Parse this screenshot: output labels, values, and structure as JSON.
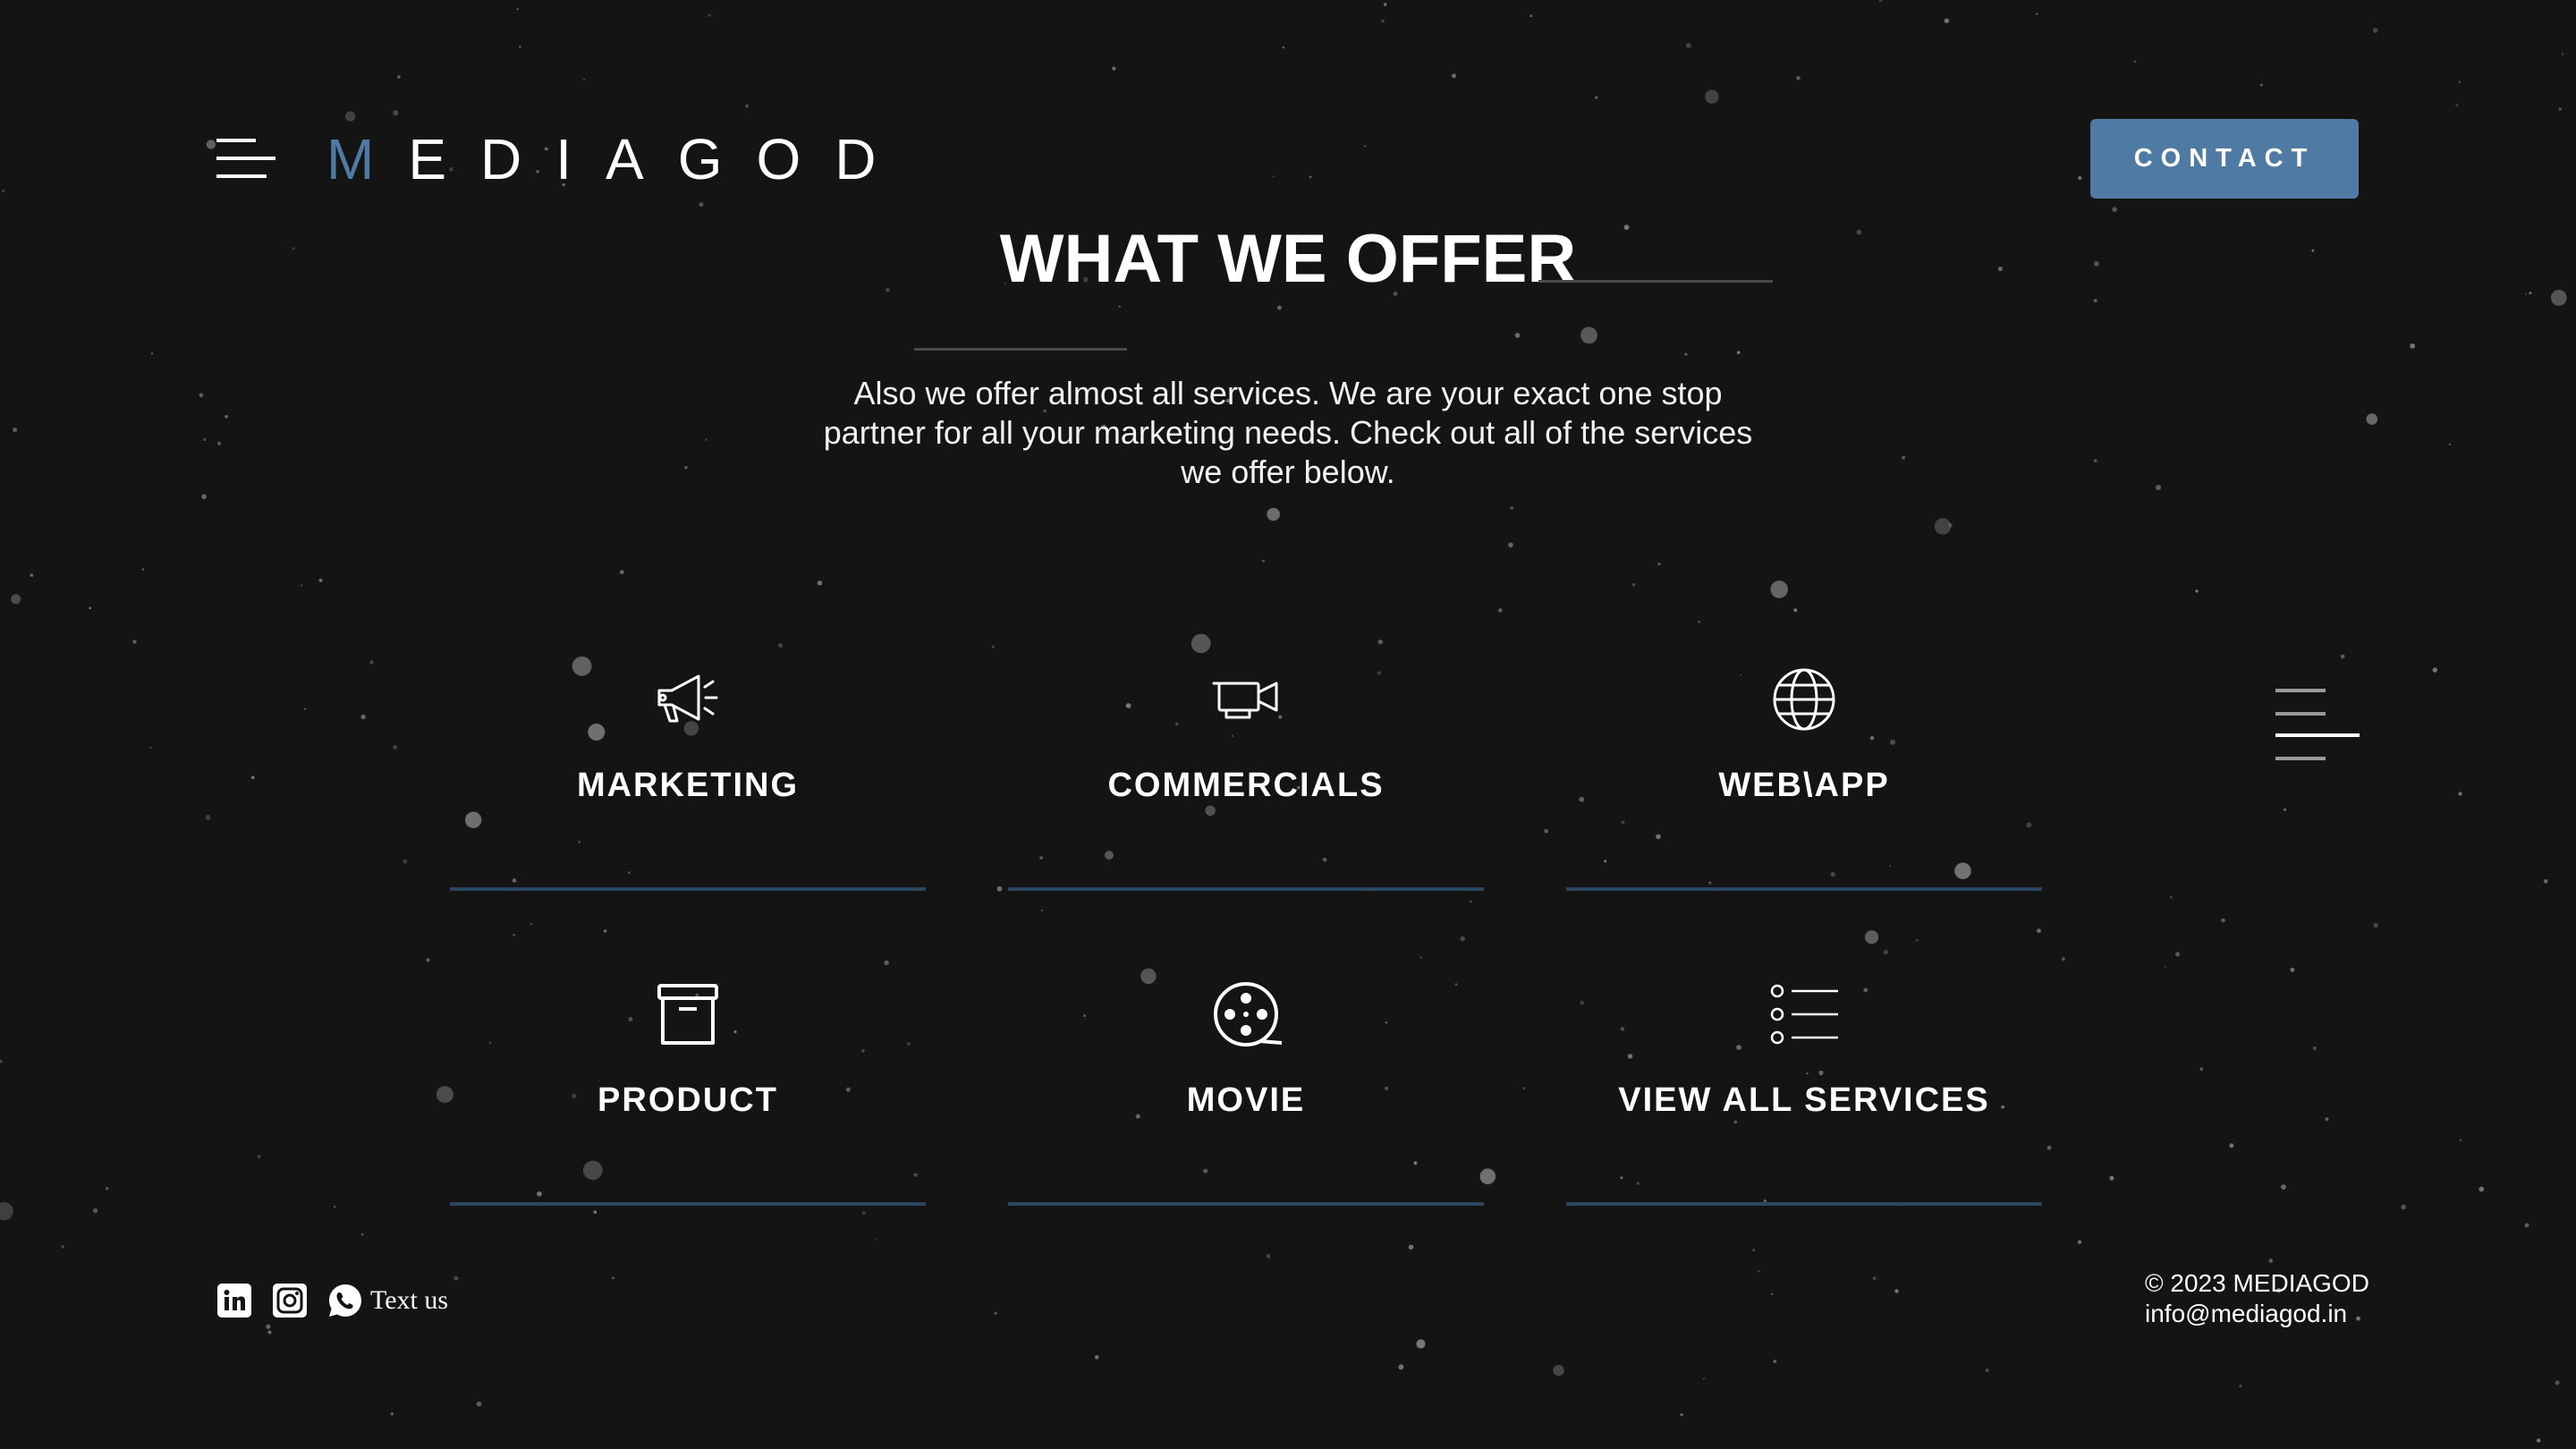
{
  "header": {
    "logo_first_letter": "M",
    "logo_rest": "EDIAGOD",
    "contact_label": "CONTACT"
  },
  "section": {
    "title": "WHAT WE OFFER",
    "intro_line1": "Also we offer almost all services. We are your exact one stop",
    "intro_line2": "partner for all your marketing needs. Check out all of the services",
    "intro_line3": "we offer below."
  },
  "services": [
    {
      "label": "MARKETING",
      "icon": "megaphone-icon"
    },
    {
      "label": "COMMERCIALS",
      "icon": "video-camera-icon"
    },
    {
      "label": "WEB\\APP",
      "icon": "globe-icon"
    },
    {
      "label": "PRODUCT",
      "icon": "archive-box-icon"
    },
    {
      "label": "MOVIE",
      "icon": "film-reel-icon"
    },
    {
      "label": "VIEW ALL SERVICES",
      "icon": "list-icon"
    }
  ],
  "footer": {
    "text_us": "Text us",
    "copyright": "© 2023 MEDIAGOD",
    "email": "info@mediagod.in"
  },
  "colors": {
    "background": "#141414",
    "accent": "#4e7aa3",
    "card_underline": "#2c4560"
  }
}
